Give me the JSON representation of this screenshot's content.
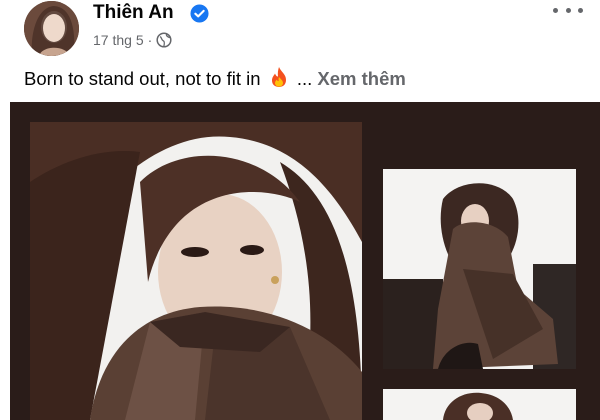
{
  "post": {
    "author_name": "Thiên An",
    "verified": true,
    "date": "17 thg 5",
    "separator": "·",
    "audience_icon": "globe-icon",
    "more_icon": "more-options-icon",
    "caption": "Born to stand out, not to fit in",
    "caption_emoji": "fire-emoji-icon",
    "ellipsis": "...",
    "see_more_label": "Xem thêm"
  },
  "colors": {
    "verified_blue": "#1877f2",
    "secondary_text": "#65676b",
    "media_background": "#2a1c19"
  },
  "media": {
    "photos": [
      {
        "name": "photo-main"
      },
      {
        "name": "photo-side"
      },
      {
        "name": "photo-third"
      }
    ]
  }
}
